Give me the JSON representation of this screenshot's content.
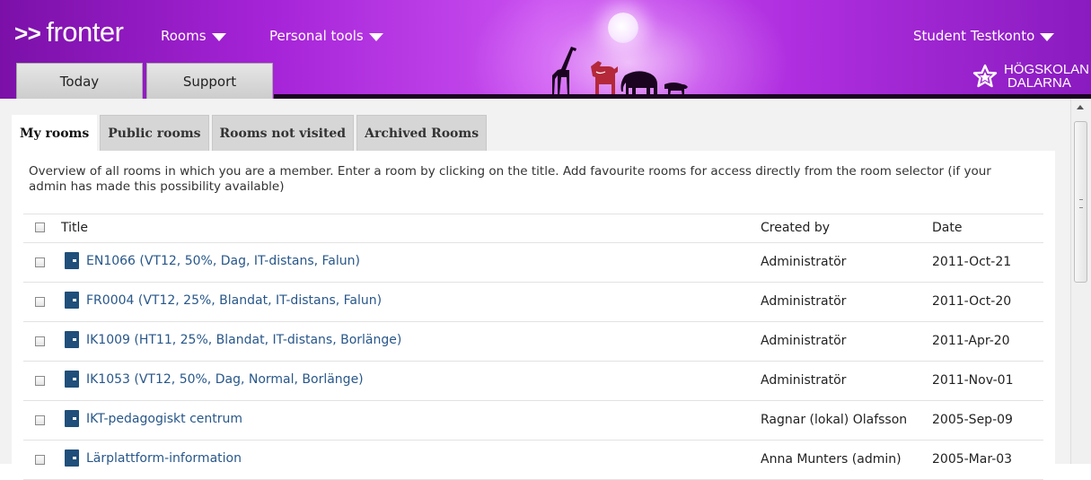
{
  "header": {
    "logo_arrows": ">>",
    "logo_text": "fronter",
    "nav": {
      "rooms": "Rooms",
      "personal_tools": "Personal tools",
      "user": "Student Testkonto"
    },
    "tabs": {
      "today": "Today",
      "support": "Support"
    },
    "brand": {
      "line1": "HÖGSKOLAN",
      "line2": "DALARNA"
    },
    "colors": {
      "banner_purple": "#a624d8",
      "link_blue": "#28578a",
      "room_icon": "#1f4f7a"
    }
  },
  "content_tabs": {
    "my_rooms": "My rooms",
    "public_rooms": "Public rooms",
    "not_visited": "Rooms not visited",
    "archived": "Archived Rooms"
  },
  "intro": "Overview of all rooms in which you are a member. Enter a room by clicking on the title. Add favourite rooms for access directly from the room selector (if your admin has made this possibility available)",
  "table": {
    "headers": {
      "title": "Title",
      "created_by": "Created by",
      "date": "Date"
    },
    "rows": [
      {
        "title": "EN1066 (VT12, 50%, Dag, IT-distans, Falun)",
        "created_by": "Administratör",
        "date": "2011-Oct-21"
      },
      {
        "title": "FR0004 (VT12, 25%, Blandat, IT-distans, Falun)",
        "created_by": "Administratör",
        "date": "2011-Oct-20"
      },
      {
        "title": "IK1009 (HT11, 25%, Blandat, IT-distans, Borlänge)",
        "created_by": "Administratör",
        "date": "2011-Apr-20"
      },
      {
        "title": "IK1053 (VT12, 50%, Dag, Normal, Borlänge)",
        "created_by": "Administratör",
        "date": "2011-Nov-01"
      },
      {
        "title": "IKT-pedagogiskt centrum",
        "created_by": "Ragnar (lokal) Olafsson",
        "date": "2005-Sep-09"
      },
      {
        "title": "Lärplattform-information",
        "created_by": "Anna Munters (admin)",
        "date": "2005-Mar-03"
      }
    ]
  }
}
